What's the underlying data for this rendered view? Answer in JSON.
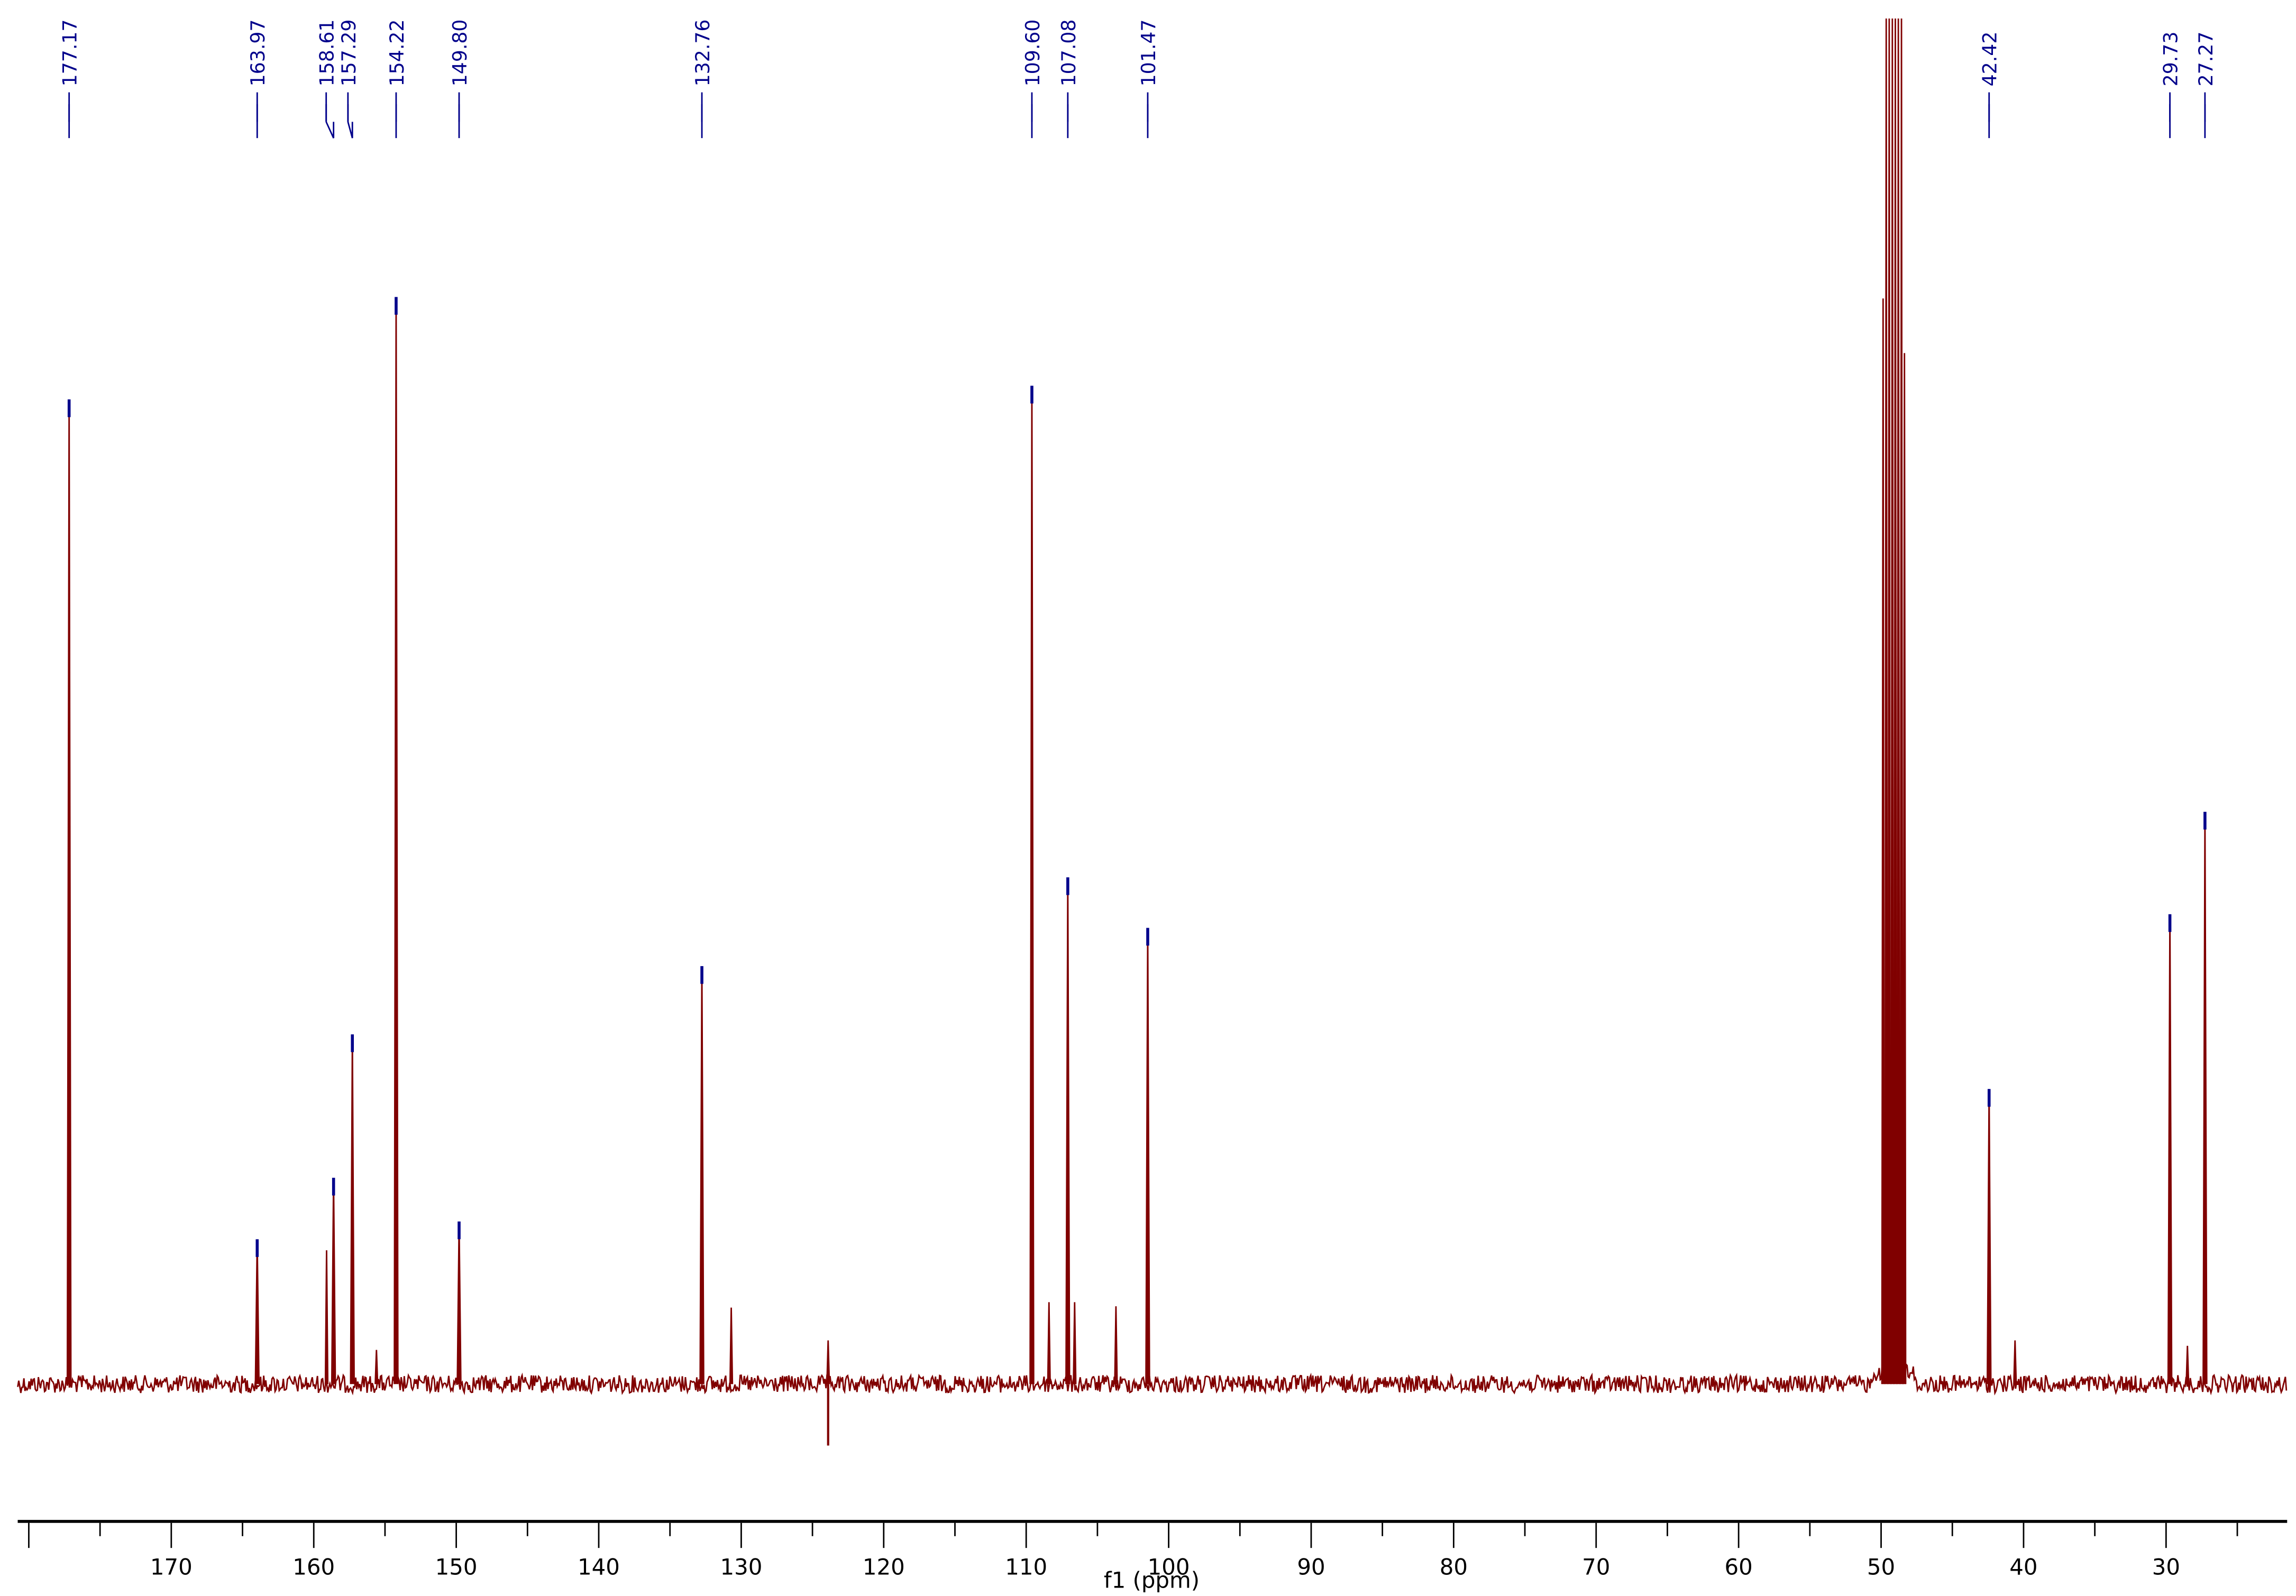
{
  "chart_data": {
    "type": "line",
    "title": "",
    "xlabel": "f1 (ppm)",
    "ylabel": "",
    "xlim": [
      180.6,
      21.5
    ],
    "x_reversed": true,
    "grid": false,
    "x_ticks": [
      170,
      160,
      150,
      140,
      130,
      120,
      110,
      100,
      90,
      80,
      70,
      60,
      50,
      40,
      30
    ],
    "x_tick_labels": [
      "170",
      "160",
      "150",
      "140",
      "130",
      "120",
      "110",
      "100",
      "90",
      "80",
      "70",
      "60",
      "50",
      "40",
      "30"
    ],
    "colors": {
      "spectrum": "#800000",
      "peak_labels": "#00008B",
      "axis": "#000000"
    },
    "labeled_peaks": [
      {
        "ppm": 177.17,
        "label": "177.17",
        "intensity": 0.72
      },
      {
        "ppm": 163.97,
        "label": "163.97",
        "intensity": 0.105
      },
      {
        "ppm": 158.61,
        "label": "158.61",
        "intensity": 0.15
      },
      {
        "ppm": 157.29,
        "label": "157.29",
        "intensity": 0.255
      },
      {
        "ppm": 154.22,
        "label": "154.22",
        "intensity": 0.795
      },
      {
        "ppm": 149.8,
        "label": "149.80",
        "intensity": 0.118
      },
      {
        "ppm": 132.76,
        "label": "132.76",
        "intensity": 0.305
      },
      {
        "ppm": 109.6,
        "label": "109.60",
        "intensity": 0.73
      },
      {
        "ppm": 107.08,
        "label": "107.08",
        "intensity": 0.37
      },
      {
        "ppm": 101.47,
        "label": "101.47",
        "intensity": 0.333
      },
      {
        "ppm": 42.42,
        "label": "42.42",
        "intensity": 0.215
      },
      {
        "ppm": 29.73,
        "label": "29.73",
        "intensity": 0.343
      },
      {
        "ppm": 27.27,
        "label": "27.27",
        "intensity": 0.418
      }
    ],
    "unlabeled_peaks": [
      {
        "ppm": 159.1,
        "intensity": 0.098
      },
      {
        "ppm": 155.6,
        "intensity": 0.025
      },
      {
        "ppm": 130.7,
        "intensity": 0.056
      },
      {
        "ppm": 123.9,
        "intensity": 0.032,
        "dispersive_min": -0.045
      },
      {
        "ppm": 108.4,
        "intensity": 0.06
      },
      {
        "ppm": 106.6,
        "intensity": 0.06
      },
      {
        "ppm": 103.7,
        "intensity": 0.057
      },
      {
        "ppm": 40.6,
        "intensity": 0.032
      },
      {
        "ppm": 28.5,
        "intensity": 0.028
      }
    ],
    "solvent_multiplet": [
      {
        "ppm": 49.86,
        "intensity": 0.795
      },
      {
        "ppm": 49.64,
        "intensity": 1.0
      },
      {
        "ppm": 49.43,
        "intensity": 1.0
      },
      {
        "ppm": 49.21,
        "intensity": 1.0
      },
      {
        "ppm": 49.0,
        "intensity": 1.0
      },
      {
        "ppm": 48.79,
        "intensity": 1.0
      },
      {
        "ppm": 48.57,
        "intensity": 1.0
      },
      {
        "ppm": 48.36,
        "intensity": 0.755
      }
    ]
  }
}
